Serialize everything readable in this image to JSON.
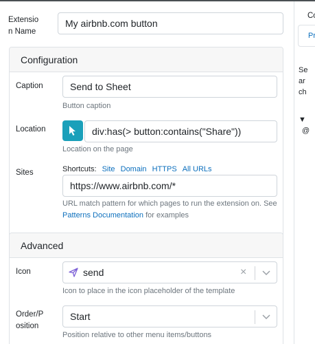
{
  "extension_name": {
    "label_line1": "Extensio",
    "label_line2": "n Name",
    "value": "My airbnb.com button"
  },
  "configuration": {
    "header": "Configuration",
    "caption": {
      "label": "Caption",
      "value": "Send to Sheet",
      "help": "Button caption"
    },
    "location": {
      "label": "Location",
      "value": "div:has(> button:contains(\"Share\"))",
      "help": "Location on the page",
      "picker_icon": "cursor-arrow-icon"
    },
    "sites": {
      "label": "Sites",
      "shortcuts_label": "Shortcuts:",
      "shortcuts": [
        "Site",
        "Domain",
        "HTTPS",
        "All URLs"
      ],
      "value": "https://www.airbnb.com/*",
      "help_text": "URL match pattern for which pages to run the extension on. See",
      "help_link": "Patterns Documentation",
      "help_suffix": "for examples"
    }
  },
  "advanced": {
    "header": "Advanced",
    "icon": {
      "label": "Icon",
      "value": "send",
      "help": "Icon to place in the icon placeholder of the template",
      "value_icon": "paper-plane-icon"
    },
    "order": {
      "label_line1": "Order/P",
      "label_line2": "osition",
      "value": "Start",
      "help": "Position relative to other menu items/buttons"
    }
  },
  "right_panel": {
    "top_link": "Co",
    "tab": "Pr",
    "lines": [
      "Se",
      "ar",
      "ch"
    ],
    "tree_toggle": "▼",
    "tree_item": "@"
  },
  "colors": {
    "accent": "#1aa0ba",
    "link": "#0c6fbd",
    "help": "#6c757d",
    "border": "#ced4da",
    "purple_icon": "#7b5fd6"
  }
}
